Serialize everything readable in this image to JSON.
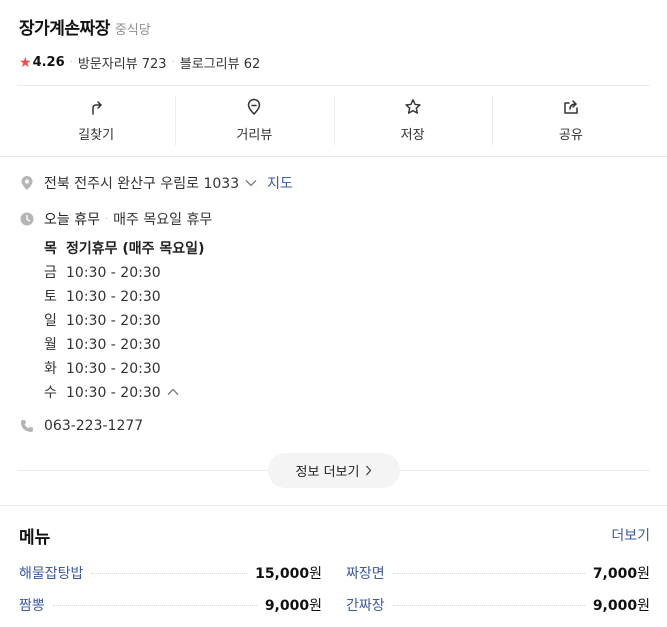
{
  "place": {
    "name": "장가계손짜장",
    "category": "중식당"
  },
  "rating": {
    "score": "4.26",
    "visitor_reviews": "방문자리뷰 723",
    "blog_reviews": "블로그리뷰 62"
  },
  "actions": [
    {
      "label": "길찾기",
      "icon": "directions-icon"
    },
    {
      "label": "거리뷰",
      "icon": "street-view-icon"
    },
    {
      "label": "저장",
      "icon": "star-outline-icon"
    },
    {
      "label": "공유",
      "icon": "share-icon"
    }
  ],
  "address": {
    "text": "전북 전주시 완산구 우림로 1033",
    "map_link": "지도"
  },
  "status": {
    "today": "오늘 휴무",
    "note": "매주 목요일 휴무"
  },
  "hours": [
    {
      "day": "목",
      "time": "정기휴무 (매주 목요일)"
    },
    {
      "day": "금",
      "time": "10:30 - 20:30"
    },
    {
      "day": "토",
      "time": "10:30 - 20:30"
    },
    {
      "day": "일",
      "time": "10:30 - 20:30"
    },
    {
      "day": "월",
      "time": "10:30 - 20:30"
    },
    {
      "day": "화",
      "time": "10:30 - 20:30"
    },
    {
      "day": "수",
      "time": "10:30 - 20:30"
    }
  ],
  "phone": "063-223-1277",
  "more_info_label": "정보 더보기",
  "menu": {
    "title": "메뉴",
    "more_label": "더보기",
    "items": [
      {
        "name": "해물잡탕밥",
        "price": "15,000",
        "unit": "원"
      },
      {
        "name": "짜장면",
        "price": "7,000",
        "unit": "원"
      },
      {
        "name": "짬뽕",
        "price": "9,000",
        "unit": "원"
      },
      {
        "name": "간짜장",
        "price": "9,000",
        "unit": "원"
      }
    ]
  },
  "colors": {
    "accent": "#3c5aa6",
    "star": "#f54b4b",
    "divider": "#ebebeb"
  }
}
